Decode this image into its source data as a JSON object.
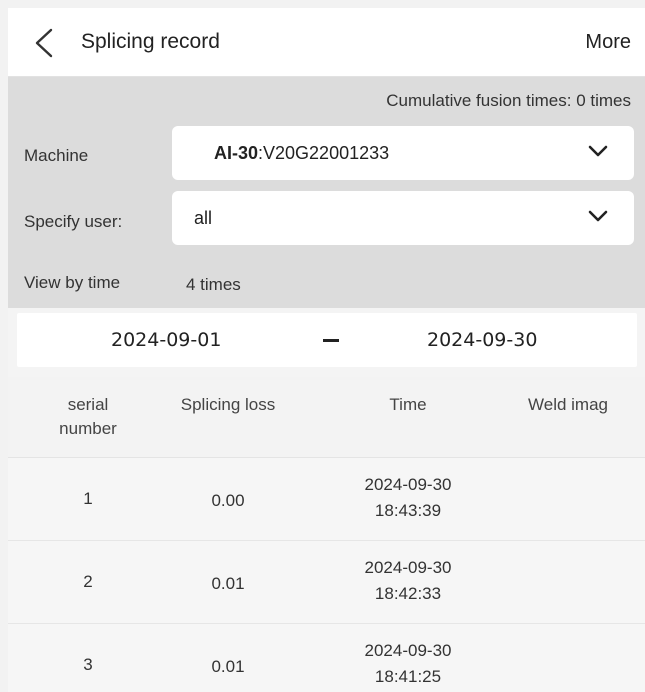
{
  "header": {
    "title": "Splicing record",
    "more_label": "More",
    "back_icon": "chevron-left-icon"
  },
  "filter": {
    "cumulative_label": "Cumulative fusion times:",
    "cumulative_value": "0 times",
    "machine_label": "Machine",
    "machine_model": "AI-30",
    "machine_serial": ":V20G22001233",
    "user_label": "Specify user:",
    "user_value": "all",
    "view_label": "View by time",
    "view_count": "4 times",
    "date_start": "2024-09-01",
    "date_end": "2024-09-30"
  },
  "table": {
    "headers": [
      "serial",
      "number",
      "Splicing loss",
      "Time",
      "Weld imag"
    ],
    "rows": [
      {
        "serial": "1",
        "loss": "0.00",
        "date": "2024-09-30",
        "time": "18:43:39"
      },
      {
        "serial": "2",
        "loss": "0.01",
        "date": "2024-09-30",
        "time": "18:42:33"
      },
      {
        "serial": "3",
        "loss": "0.01",
        "date": "2024-09-30",
        "time": "18:41:25"
      }
    ]
  },
  "colors": {
    "panel_bg": "#dcdcdc",
    "field_bg": "#ffffff",
    "text": "#222222"
  }
}
